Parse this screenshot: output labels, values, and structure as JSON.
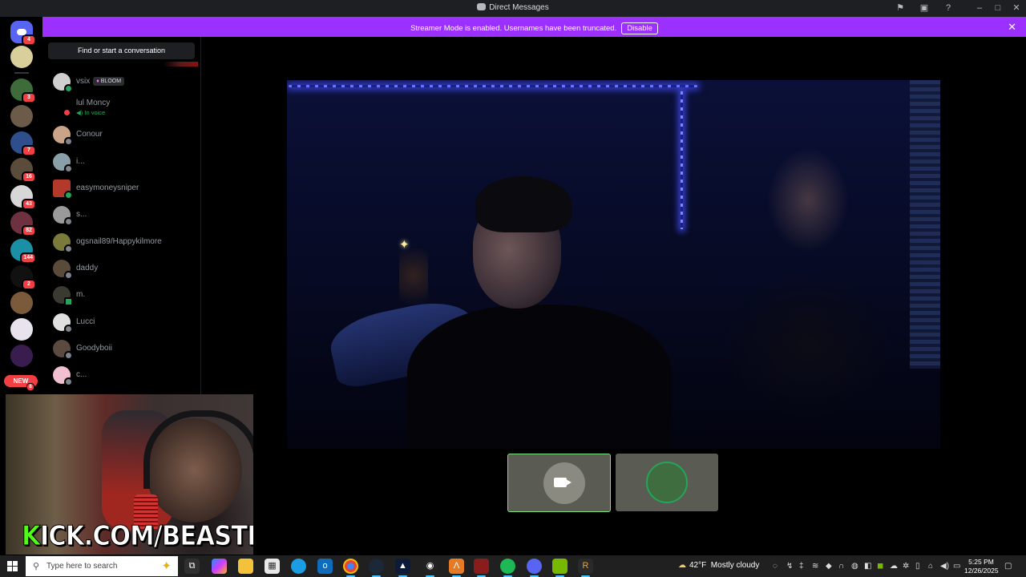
{
  "window": {
    "title": "Direct Messages"
  },
  "banner": {
    "message": "Streamer Mode is enabled. Usernames have been truncated.",
    "disable_label": "Disable"
  },
  "rail": {
    "badges": [
      "4",
      "3",
      "7",
      "16",
      "43",
      "82",
      "144",
      "2",
      "8"
    ],
    "new_label": "NEW"
  },
  "sidebar": {
    "search_label": "Find or start a conversation",
    "dms": [
      {
        "name": "vsix",
        "tag": "BLOOM",
        "status": "online"
      },
      {
        "name": "lul Moncy",
        "sub": "In voice",
        "status": "dnd"
      },
      {
        "name": "Conour",
        "status": "offline"
      },
      {
        "name": "i...",
        "status": "offline"
      },
      {
        "name": "easymoneysniper",
        "status": "online"
      },
      {
        "name": "s...",
        "status": "offline"
      },
      {
        "name": "ogsnail89/Happykilmore",
        "status": "offline"
      },
      {
        "name": "daddy",
        "status": "offline"
      },
      {
        "name": "m.",
        "status": "online"
      },
      {
        "name": "Lucci",
        "status": "offline"
      },
      {
        "name": "Goodyboii",
        "status": "offline"
      },
      {
        "name": "c...",
        "status": "offline"
      }
    ]
  },
  "overlay": {
    "kick_prefix": "K",
    "kick_rest": "ICK.COM/BEASTK"
  },
  "taskbar": {
    "search_placeholder": "Type here to search",
    "weather_temp": "42°F",
    "weather_desc": "Mostly cloudy",
    "time": "5:25 PM",
    "date": "12/26/2025"
  },
  "colors": {
    "banner": "#9b30ff",
    "online": "#23a55a",
    "dnd": "#f23f43",
    "badge": "#f23f43",
    "kick_green": "#53fc18"
  }
}
